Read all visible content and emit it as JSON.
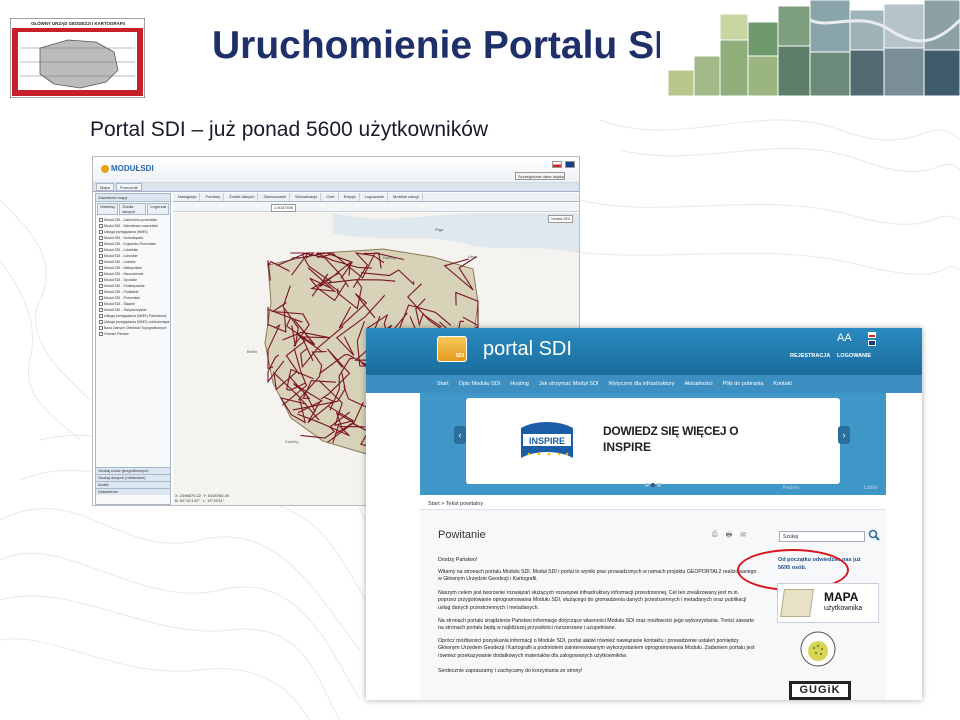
{
  "slide": {
    "title": "Uruchomienie Portalu SDI",
    "subtitle": "Portal SDI – już ponad 5600 użytkowników",
    "logo_text": "GŁÓWNY URZĄD GEODEZJI I KARTOGRAFII"
  },
  "module_sdi": {
    "logo": "MODUŁSDI",
    "user_button": "Szczegółowe dane użytkownika",
    "main_tabs": [
      "Mapa",
      "Pomocnik"
    ],
    "panel_title": "Zawartość mapy",
    "layer_tabs": [
      "Warstwy",
      "Źródła danych",
      "Legenda"
    ],
    "layers": [
      "Moduł SDI - Zachodnio-pomorskie",
      "Moduł SDI - Warmińsko-mazurskie",
      "Usługa przeglądania (WMS)",
      "Moduł SDI - Dolnośląskie",
      "Moduł SDI - Kujawsko-Pomorskie",
      "Moduł SDI - Lubelskie",
      "Moduł SDI - Lubuskie",
      "Moduł SDI - Łódzkie",
      "Moduł SDI - Małopolskie",
      "Moduł SDI - Mazowieckie",
      "Moduł SDI - Opolskie",
      "Moduł SDI - Podkarpackie",
      "Moduł SDI - Podlaskie",
      "Moduł SDI - Pomorskie",
      "Moduł SDI - Śląskie",
      "Moduł SDI - Świętokrzyskie",
      "Usługa przeglądania (WMS) Państwowy",
      "Usługa przeglądania (WMS) ortofotomapa",
      "Baza Danych Obiektów Topograficznych",
      "Granice Państw"
    ],
    "accordion": [
      "Szukaj nazw geograficznych",
      "Szukaj danych (metadane)",
      "Analiz",
      "Ustawienia"
    ],
    "toolbar": [
      "Nawigacja",
      "Pomiary",
      "Źródła danych",
      "Zaznaczanie",
      "Wizualizacja",
      "Cele",
      "Edycja",
      "Logowanie",
      "Mobilne usługi"
    ],
    "scale": "1:4047359",
    "cities": [
      "Berlin",
      "Riga",
      "Litwa",
      "Danzig",
      "Czechy"
    ],
    "coords": [
      "X: 2396579.22",
      "Y: 5169766.39",
      "B: 52°12'4.87\"",
      "L: 19°15'31\""
    ],
    "map_badge": "Moduł SDI"
  },
  "portal": {
    "title": "portal SDI",
    "logo_badge": "SDI",
    "font_switch": "AA",
    "register": "REJESTRACJA",
    "login": "LOGOWANIE",
    "nav": [
      "Start",
      "Opis Modułu SDI",
      "Hosting",
      "Jak otrzymać Moduł SDI",
      "Wytyczne dla infrastruktury",
      "Aktualności",
      "Pliki do pobrania",
      "Kontakt"
    ],
    "banner_line1": "DOWIEDZ SIĘ WIĘCEJ O",
    "banner_line2": "INSPIRE",
    "inspire_label": "INSPIRE",
    "ghost_left": "Radom",
    "ghost_right": "Lublin",
    "breadcrumb": "Start > Tekst powitalny",
    "welcome": "Powitanie",
    "search_value": "Szukaj",
    "visits": "Od początku odwiedziło nas już 5695 osób.",
    "mapa_title": "MAPA",
    "mapa_sub": "użytkownika",
    "guk": "GUGiK",
    "paragraphs": [
      "Drodzy Państwo!",
      "Witamy na stronach portalu Modułu SDI. Moduł SDI i portal to wyniki prac prowadzonych w ramach projektu GEOPORTAL2 realizowanego w Głównym Urzędzie Geodezji i Kartografii.",
      "Naszym celem jest tworzenie rozwiązań służących rozwojowi infrastruktury informacji przestrzennej. Cel ten zrealizowany jest m.in. poprzez przygotowanie oprogramowania Modułu SDI, służącego do gromadzenia danych przestrzennych i metadanych oraz publikacji usług danych przestrzennych i metadanych.",
      "Na stronach portalu znajdziecie Państwo informacje dotyczące własności Modułu SDI oraz możliwości jego wykorzystania. Treści zawarte na stronach portalu będą w najbliższej przyszłości rozszerzane i uzupełniane.",
      "Oprócz możliwości pozyskania informacji o Module SDI, portal ułatwi również nawiązanie kontaktu i prowadzenie ustaleń pomiędzy Głównym Urzędem Geodezji i Kartografii a podmiotem zainteresowanym wykorzystaniem oprogramowania Modułu. Zadaniem portalu jest również przekazywanie dodatkowych materiałów dla zalogowanych użytkowników.",
      "Serdecznie zapraszamy i zachęcamy do korzystania ze strony!"
    ]
  }
}
